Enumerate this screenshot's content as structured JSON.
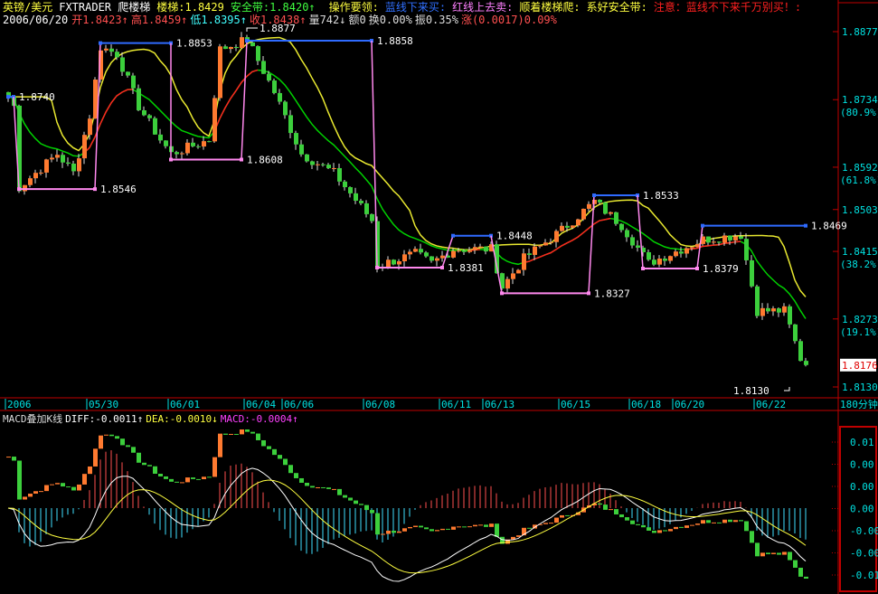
{
  "header": {
    "symbol": "英镑/美元",
    "indicator": "FXTRADER 爬楼梯",
    "ladder": "楼梯:1.8429",
    "safety_belt": "安全带:1.8420↑",
    "tips_title": "操作要领:",
    "tip_blue": "蓝线下来买:",
    "tip_red": "红线上去卖:",
    "tip_follow": "顺着楼梯爬:",
    "tip_belt": "系好安全带:",
    "warning": "注意：蓝线不下来千万别买！:",
    "date": "2006/06/20",
    "open": "开1.8423↑",
    "high": "高1.8459↑",
    "low": "低1.8395↑",
    "close": "收1.8438↑",
    "volume": "量742↓",
    "amount": "额0",
    "turnover": "换0.00%",
    "amplitude": "振0.35%",
    "change": "涨(0.0017)0.09%"
  },
  "macd_header": {
    "title": "MACD叠加K线",
    "diff": "DIFF:-0.0011↑",
    "dea": "DEA:-0.0010↓",
    "macd": "MACD:-0.0004↑"
  },
  "period_label": "180分钟",
  "colors": {
    "up": "#ff7a30",
    "down": "#3ccf3c",
    "blue": "#2f6bff",
    "pink": "#ff88ee",
    "yellow": "#e8e830",
    "green": "#00d000",
    "red": "#ff2020",
    "axis": "#00e0e0",
    "frame": "#c00000"
  },
  "chart_data": {
    "type": "candlestick",
    "price_range": [
      1.813,
      1.8877
    ],
    "y_ticks": [
      {
        "price": 1.8877,
        "label": "1.8877"
      },
      {
        "price": 1.8734,
        "label": "1.8734",
        "pct": "(80.9%)"
      },
      {
        "price": 1.8592,
        "label": "1.8592",
        "pct": "(61.8%)"
      },
      {
        "price": 1.8503,
        "label": "1.8503"
      },
      {
        "price": 1.8415,
        "label": "1.8415",
        "pct": "(38.2%)"
      },
      {
        "price": 1.8273,
        "label": "1.8273",
        "pct": "(19.1%)"
      },
      {
        "price": 1.813,
        "label": "1.8130"
      }
    ],
    "current_price": {
      "price": 1.8176,
      "label": "1.8176"
    },
    "x_labels": [
      {
        "i": 0,
        "label": "2006"
      },
      {
        "i": 15,
        "label": "05/30"
      },
      {
        "i": 30,
        "label": "06/01"
      },
      {
        "i": 44,
        "label": "06/04"
      },
      {
        "i": 51,
        "label": "06/06"
      },
      {
        "i": 66,
        "label": "06/08"
      },
      {
        "i": 80,
        "label": "06/11"
      },
      {
        "i": 88,
        "label": "06/13"
      },
      {
        "i": 102,
        "label": "06/15"
      },
      {
        "i": 115,
        "label": "06/18"
      },
      {
        "i": 123,
        "label": "06/20"
      },
      {
        "i": 138,
        "label": "06/22"
      }
    ],
    "candle_count": 148,
    "price_path": [
      [
        0,
        1.874
      ],
      [
        1,
        1.872
      ],
      [
        2,
        1.855
      ],
      [
        9,
        1.862
      ],
      [
        12,
        1.858
      ],
      [
        15,
        1.87
      ],
      [
        17,
        1.8845
      ],
      [
        20,
        1.883
      ],
      [
        24,
        1.872
      ],
      [
        28,
        1.865
      ],
      [
        30,
        1.862
      ],
      [
        37,
        1.865
      ],
      [
        39,
        1.884
      ],
      [
        44,
        1.886
      ],
      [
        49,
        1.875
      ],
      [
        54,
        1.862
      ],
      [
        60,
        1.858
      ],
      [
        67,
        1.848
      ],
      [
        68,
        1.8385
      ],
      [
        75,
        1.841
      ],
      [
        78,
        1.839
      ],
      [
        82,
        1.842
      ],
      [
        89,
        1.842
      ],
      [
        91,
        1.834
      ],
      [
        95,
        1.84
      ],
      [
        102,
        1.846
      ],
      [
        108,
        1.852
      ],
      [
        113,
        1.847
      ],
      [
        118,
        1.839
      ],
      [
        122,
        1.841
      ],
      [
        128,
        1.844
      ],
      [
        135,
        1.845
      ],
      [
        138,
        1.829
      ],
      [
        143,
        1.829
      ],
      [
        146,
        1.819
      ],
      [
        147,
        1.8176
      ]
    ],
    "ladder": [
      {
        "kind": "blue",
        "from": 0,
        "to": 1,
        "price": 1.874,
        "label": "1.8740"
      },
      {
        "kind": "pink",
        "from": 2,
        "to": 16,
        "price": 1.8546,
        "label": "1.8546"
      },
      {
        "kind": "blue",
        "from": 17,
        "to": 30,
        "price": 1.8853,
        "label": "1.8853"
      },
      {
        "kind": "pink",
        "from": 30,
        "to": 43,
        "price": 1.8608,
        "label": "1.8608"
      },
      {
        "kind": "blue",
        "from": 44,
        "to": 67,
        "price": 1.8858,
        "label": "1.8858"
      },
      {
        "kind": "pink",
        "from": 68,
        "to": 80,
        "price": 1.8381,
        "label": "1.8381"
      },
      {
        "kind": "blue",
        "from": 82,
        "to": 89,
        "price": 1.8448,
        "label": "1.8448"
      },
      {
        "kind": "pink",
        "from": 91,
        "to": 107,
        "price": 1.8327,
        "label": "1.8327"
      },
      {
        "kind": "blue",
        "from": 108,
        "to": 116,
        "price": 1.8533,
        "label": "1.8533"
      },
      {
        "kind": "pink",
        "from": 117,
        "to": 127,
        "price": 1.8379,
        "label": "1.8379"
      },
      {
        "kind": "blue",
        "from": 128,
        "to": 147,
        "price": 1.8469,
        "label": "1.8469"
      }
    ],
    "extremes": [
      {
        "i": 44,
        "price": 1.8877,
        "label": "1.8877",
        "kind": "high"
      },
      {
        "i": 144,
        "price": 1.813,
        "label": "1.8130",
        "kind": "low"
      }
    ],
    "macd_ticks": [
      "0.01",
      "0.00",
      "0.00",
      "0.00",
      "-0.00",
      "-0.00",
      "-0.01"
    ]
  }
}
